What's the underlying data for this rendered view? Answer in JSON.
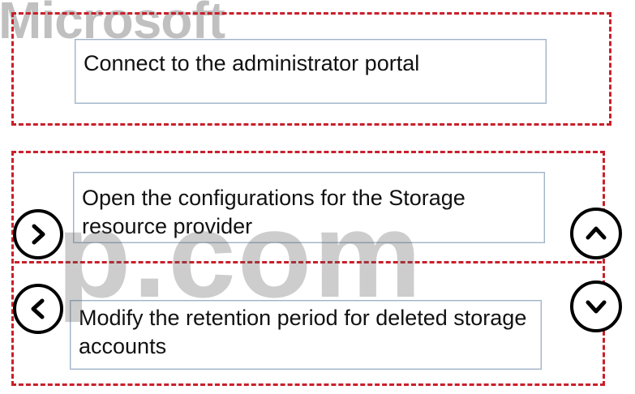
{
  "watermark": {
    "top_text": "Microsoft",
    "center_text": "p.com"
  },
  "top_zone": {
    "items": [
      {
        "label": "Connect to the administrator portal"
      }
    ]
  },
  "bottom_zone": {
    "items": [
      {
        "label": "Open the configurations for the Storage resource provider"
      },
      {
        "label": "Modify the retention period for deleted storage accounts"
      }
    ]
  },
  "controls": {
    "move_right": "chevron-right-icon",
    "move_left": "chevron-left-icon",
    "move_up": "chevron-up-icon",
    "move_down": "chevron-down-icon"
  },
  "colors": {
    "dash_border": "#c8202b",
    "card_border": "#9fb3c7"
  }
}
